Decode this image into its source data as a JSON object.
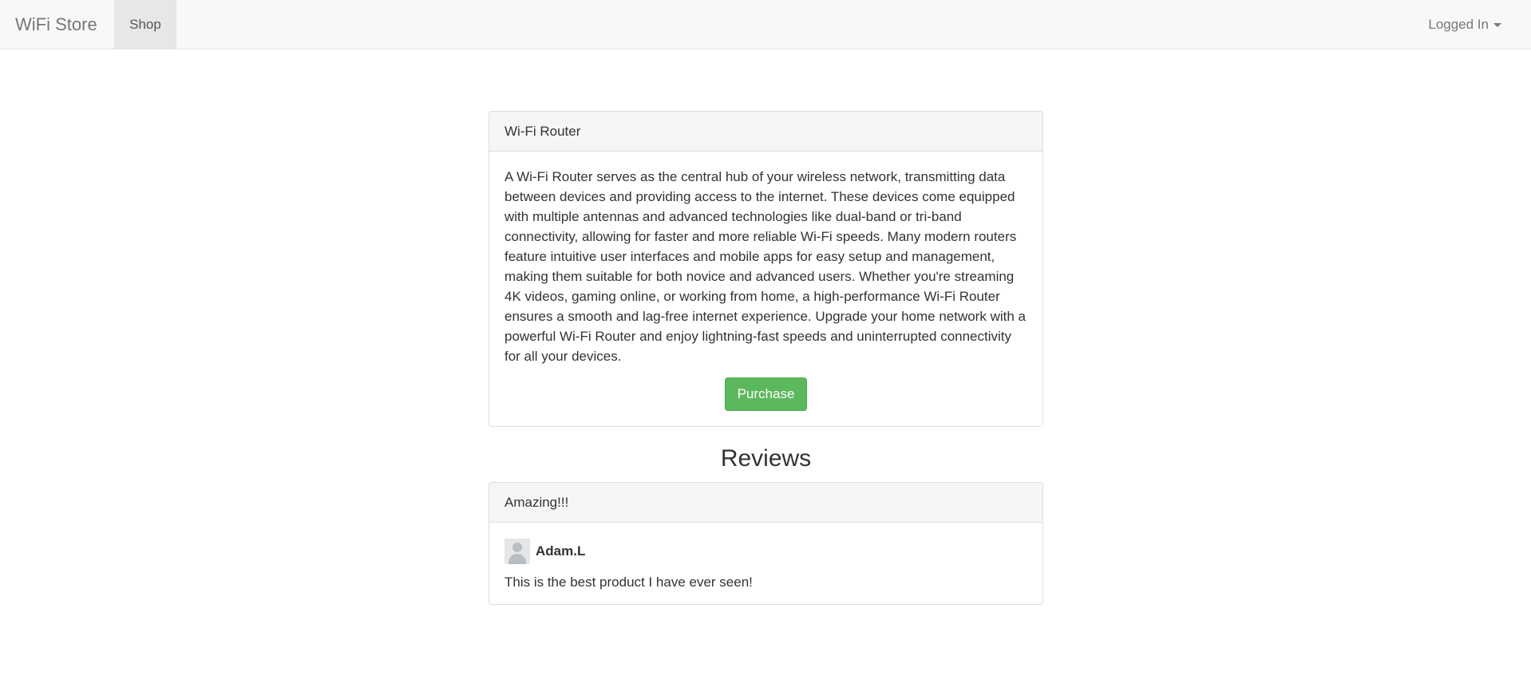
{
  "nav": {
    "brand": "WiFi Store",
    "shop": "Shop",
    "user_menu": "Logged In"
  },
  "product": {
    "title": "Wi-Fi Router",
    "description": "A Wi-Fi Router serves as the central hub of your wireless network, transmitting data between devices and providing access to the internet. These devices come equipped with multiple antennas and advanced technologies like dual-band or tri-band connectivity, allowing for faster and more reliable Wi-Fi speeds. Many modern routers feature intuitive user interfaces and mobile apps for easy setup and management, making them suitable for both novice and advanced users. Whether you're streaming 4K videos, gaming online, or working from home, a high-performance Wi-Fi Router ensures a smooth and lag-free internet experience. Upgrade your home network with a powerful Wi-Fi Router and enjoy lightning-fast speeds and uninterrupted connectivity for all your devices.",
    "purchase_label": "Purchase"
  },
  "reviews": {
    "heading": "Reviews",
    "items": [
      {
        "title": "Amazing!!!",
        "author": "Adam.L",
        "text": "This is the best product I have ever seen!"
      }
    ]
  },
  "colors": {
    "navbar_bg": "#f8f8f8",
    "active_nav_bg": "#e7e7e7",
    "success": "#5cb85c"
  },
  "icons": {
    "caret": "caret-down-icon",
    "avatar": "default-avatar-icon"
  }
}
